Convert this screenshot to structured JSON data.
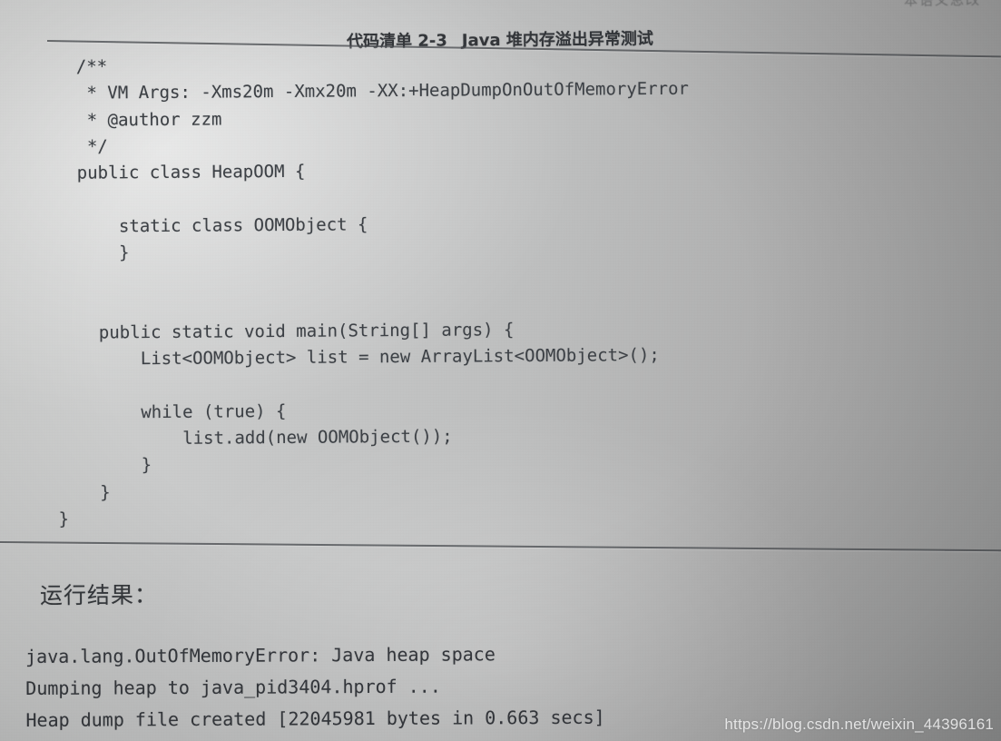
{
  "page": {
    "running_head": "本语义息改",
    "paper_color": "#c2c3c3",
    "ink_color": "#3c4045"
  },
  "caption": {
    "listing_label": "代码清单 2-3",
    "title": "Java 堆内存溢出异常测试"
  },
  "code": {
    "language": "java",
    "lines": [
      "    /**",
      "     * VM Args: -Xms20m -Xmx20m -XX:+HeapDumpOnOutOfMemoryError",
      "     * @author zzm",
      "     */",
      "    public class HeapOOM {",
      "",
      "        static class OOMObject {",
      "        }",
      "",
      "",
      "      public static void main(String[] args) {",
      "          List<OOMObject> list = new ArrayList<OOMObject>();",
      "",
      "          while (true) {",
      "              list.add(new OOMObject());",
      "          }",
      "      }",
      "  }"
    ]
  },
  "result": {
    "heading": "运行结果：",
    "console_lines": [
      "java.lang.OutOfMemoryError: Java heap space",
      "Dumping heap to java_pid3404.hprof ...",
      "Heap dump file created [22045981 bytes in 0.663 secs]"
    ]
  },
  "watermark": {
    "text": "https://blog.csdn.net/weixin_44396161"
  }
}
